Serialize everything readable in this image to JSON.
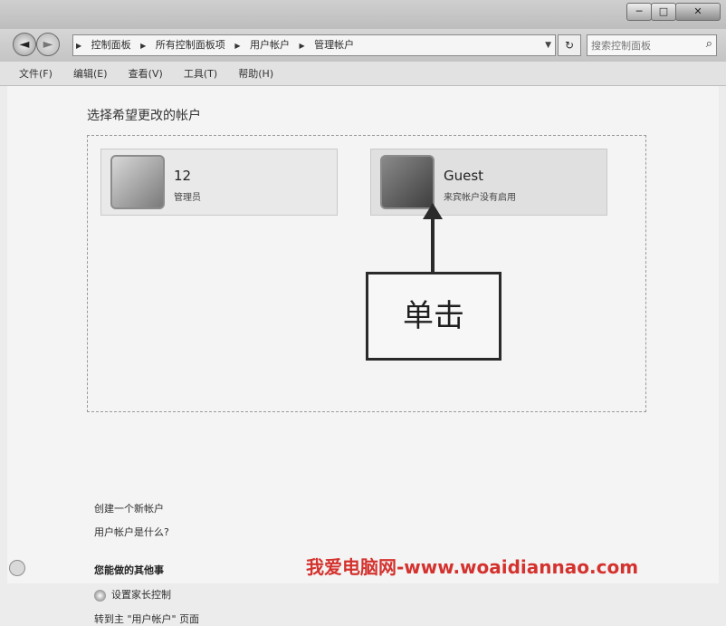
{
  "window": {
    "minimize_glyph": "─",
    "maximize_glyph": "□",
    "close_glyph": "✕"
  },
  "nav": {
    "back_glyph": "◄",
    "forward_glyph": "►",
    "breadcrumb": [
      "控制面板",
      "所有控制面板项",
      "用户帐户",
      "管理帐户"
    ],
    "refresh_glyph": "↻",
    "search_placeholder": "搜索控制面板"
  },
  "menu": [
    "文件(F)",
    "编辑(E)",
    "查看(V)",
    "工具(T)",
    "帮助(H)"
  ],
  "main": {
    "heading": "选择希望更改的帐户",
    "accounts": [
      {
        "name": "12",
        "role": "管理员",
        "icon": "admin-user-icon"
      },
      {
        "name": "Guest",
        "role": "来宾帐户没有启用",
        "icon": "guest-user-icon"
      }
    ],
    "annotation": "单击",
    "links": {
      "create": "创建一个新帐户",
      "what": "用户帐户是什么?"
    },
    "section_title": "您能做的其他事",
    "tasks": {
      "parental": "设置家长控制",
      "goto": "转到主 \"用户帐户\" 页面"
    }
  },
  "watermark": "我爱电脑网-www.woaidiannao.com"
}
